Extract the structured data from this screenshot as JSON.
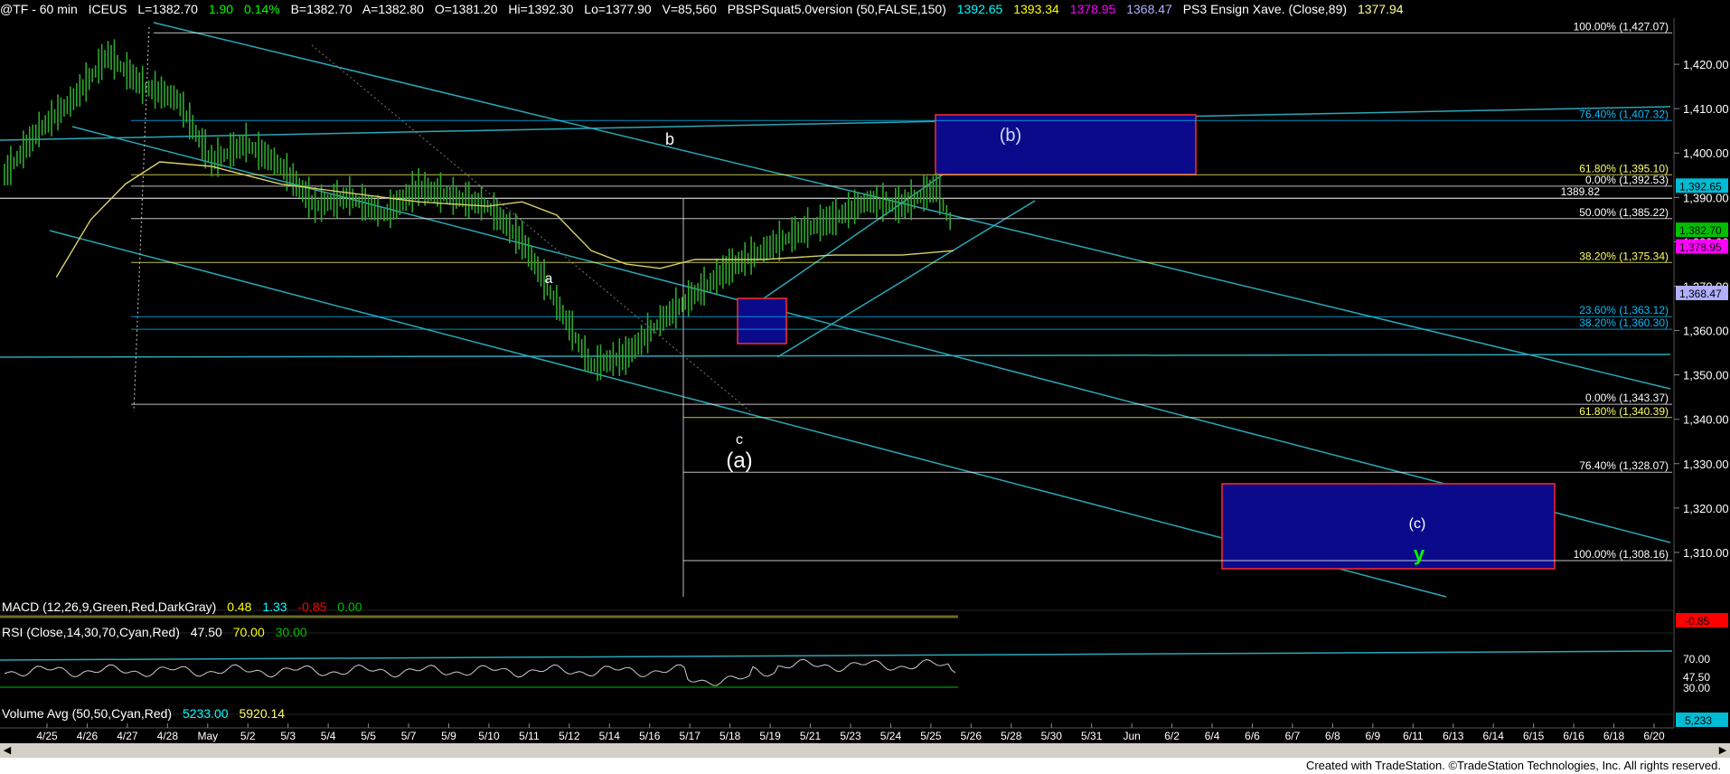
{
  "header": {
    "symbol": "@TF - 60 min",
    "exchange": "ICEUS",
    "last": "L=1382.70",
    "change": "1.90",
    "change_pct": "0.14%",
    "bid": "B=1382.70",
    "ask": "A=1382.80",
    "open": "O=1381.20",
    "high": "Hi=1392.30",
    "low": "Lo=1377.90",
    "volume": "V=85,560",
    "study1": "PBSPSquat5.0version (50,FALSE,150)",
    "study1_v1": "1392.65",
    "study1_v2": "1393.34",
    "study1_v3": "1378.95",
    "study1_v4": "1368.47",
    "study2": "PS3 Ensign Xave. (Close,89)",
    "study2_v": "1377.94",
    "colors": {
      "default": "#ffffff",
      "change": "#00ff00",
      "v1": "#00ffff",
      "v2": "#ffff00",
      "v3": "#ff00ff",
      "v4": "#b0b0ff",
      "v5": "#ffff99"
    }
  },
  "macd": {
    "label": "MACD (12,26,9,Green,Red,DarkGray)",
    "v1": "0.48",
    "v2": "1.33",
    "v3": "-0.85",
    "v4": "0.00",
    "axis_label": "-0.85"
  },
  "rsi": {
    "label": "RSI (Close,14,30,70,Cyan,Red)",
    "v1": "47.50",
    "v2": "70.00",
    "v3": "30.00",
    "axis_labels": [
      "70.00",
      "47.50",
      "30.00"
    ]
  },
  "volume": {
    "label": "Volume Avg (50,50,Cyan,Red)",
    "v1": "5233.00",
    "v2": "5920.14",
    "axis_label": "5,233"
  },
  "footer": {
    "text": "Created with TradeStation. ©TradeStation Technologies, Inc. All rights reserved."
  },
  "chart_data": {
    "type": "candlestick",
    "ylim": [
      1300,
      1430
    ],
    "y_ticks": [
      1310,
      1320,
      1330,
      1340,
      1350,
      1360,
      1370,
      1380,
      1390,
      1400,
      1410,
      1420
    ],
    "y_tick_labels": [
      "1,310.00",
      "1,320.00",
      "1,330.00",
      "1,340.00",
      "1,350.00",
      "1,360.00",
      "1,370.00",
      "1,380.00",
      "1,390.00",
      "1,400.00",
      "1,410.00",
      "1,420.00"
    ],
    "x_tick_labels": [
      "4/25",
      "4/26",
      "4/27",
      "4/28",
      "May",
      "5/2",
      "5/3",
      "5/4",
      "5/5",
      "5/7",
      "5/9",
      "5/10",
      "5/11",
      "5/12",
      "5/14",
      "5/16",
      "5/17",
      "5/18",
      "5/19",
      "5/21",
      "5/23",
      "5/24",
      "5/25",
      "5/26",
      "5/28",
      "5/30",
      "5/31",
      "Jun",
      "6/2",
      "6/4",
      "6/6",
      "6/7",
      "6/8",
      "6/9",
      "6/11",
      "6/13",
      "6/14",
      "6/15",
      "6/16",
      "6/18",
      "6/20"
    ],
    "price_path": [
      [
        0,
        1395
      ],
      [
        1,
        1405
      ],
      [
        2,
        1412
      ],
      [
        3,
        1422
      ],
      [
        4,
        1415
      ],
      [
        5,
        1412
      ],
      [
        6,
        1398
      ],
      [
        7,
        1402
      ],
      [
        8,
        1397
      ],
      [
        9,
        1388
      ],
      [
        10,
        1390
      ],
      [
        11,
        1386
      ],
      [
        12,
        1392
      ],
      [
        13,
        1390
      ],
      [
        14,
        1388
      ],
      [
        15,
        1380
      ],
      [
        16,
        1366
      ],
      [
        17,
        1352
      ],
      [
        18,
        1354
      ],
      [
        19,
        1362
      ],
      [
        20,
        1368
      ],
      [
        21,
        1374
      ],
      [
        22,
        1378
      ],
      [
        23,
        1382
      ],
      [
        24,
        1385
      ],
      [
        25,
        1389
      ],
      [
        26,
        1388
      ],
      [
        27,
        1392
      ],
      [
        27.5,
        1382.7
      ]
    ],
    "ma_path": [
      [
        1.5,
        1372
      ],
      [
        2.5,
        1385
      ],
      [
        3.5,
        1393
      ],
      [
        4.5,
        1398
      ],
      [
        6,
        1397
      ],
      [
        8,
        1393
      ],
      [
        10,
        1391
      ],
      [
        12,
        1389
      ],
      [
        14,
        1388
      ],
      [
        15,
        1389
      ],
      [
        16,
        1386
      ],
      [
        17,
        1378
      ],
      [
        18,
        1375
      ],
      [
        19,
        1374
      ],
      [
        20,
        1376
      ],
      [
        22,
        1376
      ],
      [
        24,
        1377
      ],
      [
        26,
        1377
      ],
      [
        27.5,
        1378
      ]
    ],
    "fib_levels": [
      {
        "label": "100.00% (1,427.07)",
        "value": 1427.07,
        "color": "#ffffff"
      },
      {
        "label": "76.40% (1,407.32)",
        "value": 1407.32,
        "color": "#00bfff"
      },
      {
        "label": "61.80% (1,395.10)",
        "value": 1395.1,
        "color": "#ffff66"
      },
      {
        "label": "0.00% (1,392.53)",
        "value": 1392.53,
        "color": "#ffffff"
      },
      {
        "label": "50.00% (1,385.22)",
        "value": 1385.22,
        "color": "#ffffff"
      },
      {
        "label": "38.20% (1,375.34)",
        "value": 1375.34,
        "color": "#ffff66"
      },
      {
        "label": "23.60% (1,363.12)",
        "value": 1363.12,
        "color": "#00bfff"
      },
      {
        "label": "38.20% (1,360.30)",
        "value": 1360.3,
        "color": "#00bfff"
      },
      {
        "label": "0.00% (1,343.37)",
        "value": 1343.37,
        "color": "#ffffff"
      },
      {
        "label": "61.80% (1,340.39)",
        "value": 1340.39,
        "color": "#ffff66"
      },
      {
        "label": "76.40% (1,328.07)",
        "value": 1328.07,
        "color": "#ffffff"
      },
      {
        "label": "100.00% (1,308.16)",
        "value": 1308.16,
        "color": "#ffffff"
      }
    ],
    "level_1389": {
      "label": "1389.82",
      "value": 1389.82
    },
    "axis_badges": [
      {
        "label": "1,392.65",
        "value": 1392.65,
        "bg": "#00bcd4",
        "fg": "#000000"
      },
      {
        "label": "1,382.70",
        "value": 1382.7,
        "bg": "#00c000",
        "fg": "#000000"
      },
      {
        "label": "1,378.95",
        "value": 1378.95,
        "bg": "#ff00ff",
        "fg": "#000000"
      },
      {
        "label": "1,368.47",
        "value": 1368.47,
        "bg": "#b0b0ff",
        "fg": "#000000"
      }
    ],
    "wave_labels": [
      {
        "text": "b",
        "color": "#ffffff"
      },
      {
        "text": "a",
        "color": "#ffffff"
      },
      {
        "text": "c",
        "color": "#ffffff"
      },
      {
        "text": "(a)",
        "color": "#ffffff"
      },
      {
        "text": "(b)",
        "color": "#cce0ff"
      },
      {
        "text": "(c)",
        "color": "#ffffff"
      },
      {
        "text": "y",
        "color": "#00ff00"
      }
    ]
  }
}
